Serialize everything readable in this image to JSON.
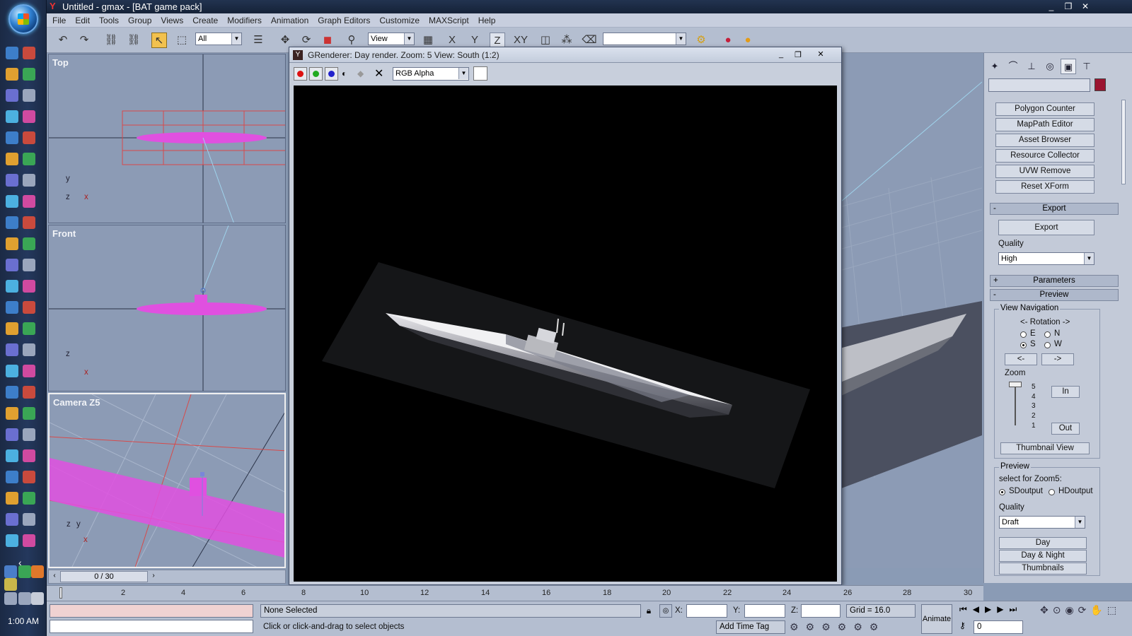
{
  "window": {
    "title": "Untitled - gmax - [BAT game pack]",
    "minimize": "_",
    "restore": "❐",
    "close": "✕"
  },
  "menu": [
    "File",
    "Edit",
    "Tools",
    "Group",
    "Views",
    "Create",
    "Modifiers",
    "Animation",
    "Graph Editors",
    "Customize",
    "MAXScript",
    "Help"
  ],
  "toolbar": {
    "selection_filter": "All",
    "reference_coord": "View",
    "axis_x": "X",
    "axis_y": "Y",
    "axis_z": "Z",
    "axis_xy": "XY",
    "named_selection": ""
  },
  "viewports": {
    "top": {
      "label": "Top",
      "axis_y": "y",
      "axis_z": "z",
      "axis_x": "x"
    },
    "front": {
      "label": "Front",
      "axis_z": "z",
      "axis_x": "x"
    },
    "camera": {
      "label": "Camera Z5",
      "axis_z": "z",
      "axis_y": "y",
      "axis_x": "x"
    }
  },
  "render_window": {
    "title": "GRenderer: Day render. Zoom: 5 View: South (1:2)",
    "channel": "RGB Alpha",
    "clear": "✕"
  },
  "command_panel": {
    "utility_buttons": [
      "Polygon Counter",
      "MapPath Editor",
      "Asset Browser",
      "Resource Collector",
      "UVW Remove",
      "Reset XForm"
    ],
    "export_rollout": "Export",
    "export_button": "Export",
    "quality_label": "Quality",
    "quality_value": "High",
    "parameters_rollout": "Parameters",
    "preview_rollout": "Preview",
    "view_navigation": "View Navigation",
    "rotation_label": "<- Rotation ->",
    "dirs": {
      "e": "E",
      "n": "N",
      "s": "S",
      "w": "W"
    },
    "rotate_left": "<-",
    "rotate_right": "->",
    "zoom_label": "Zoom",
    "zoom_levels": [
      "5",
      "4",
      "3",
      "2",
      "1"
    ],
    "zoom_in": "In",
    "zoom_out": "Out",
    "thumbnail_view": "Thumbnail View",
    "preview_group": "Preview",
    "select_for": "select for Zoom5:",
    "sd_output": "SDoutput",
    "hd_output": "HDoutput",
    "quality2_label": "Quality",
    "quality2_value": "Draft",
    "day": "Day",
    "day_night": "Day & Night",
    "thumbnails": "Thumbnails"
  },
  "timeline": {
    "frame_counter": "0 / 30",
    "ticks": [
      "2",
      "4",
      "6",
      "8",
      "10",
      "12",
      "14",
      "16",
      "18",
      "20",
      "22",
      "24",
      "26",
      "28",
      "30"
    ]
  },
  "status": {
    "selection": "None Selected",
    "prompt": "Click or click-and-drag to select objects",
    "x_label": "X:",
    "y_label": "Y:",
    "z_label": "Z:",
    "grid": "Grid = 16.0",
    "animate": "Animate",
    "add_time_tag": "Add Time Tag",
    "current_frame": "0"
  },
  "system": {
    "clock": "1:00 AM"
  }
}
